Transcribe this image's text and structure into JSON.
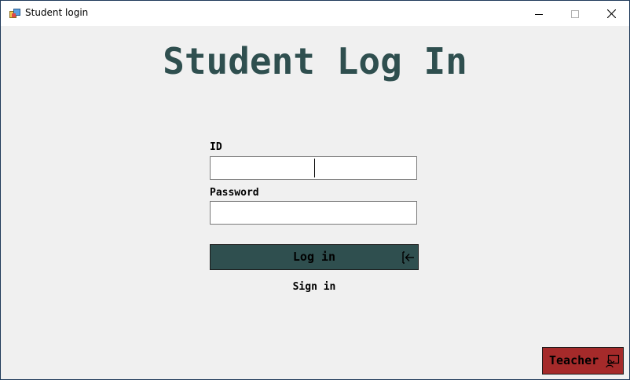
{
  "window": {
    "title": "Student login"
  },
  "titlebar": {
    "app_icon": "winforms-app-icon",
    "minimize_icon": "minimize-icon",
    "maximize_icon": "maximize-icon",
    "close_icon": "close-icon"
  },
  "page": {
    "title": "Student Log In"
  },
  "form": {
    "id_label": "ID",
    "id_value": "",
    "password_label": "Password",
    "password_value": "",
    "login_label": "Log in",
    "login_icon": "log-in-icon",
    "signin_label": "Sign in"
  },
  "footer": {
    "teacher_label": "Teacher",
    "teacher_icon": "presentation-icon"
  },
  "colors": {
    "title_color": "#2f4f4f",
    "login_bg": "#2f4f4f",
    "teacher_bg": "#a52a2a",
    "window_bg": "#f0f0f0"
  }
}
